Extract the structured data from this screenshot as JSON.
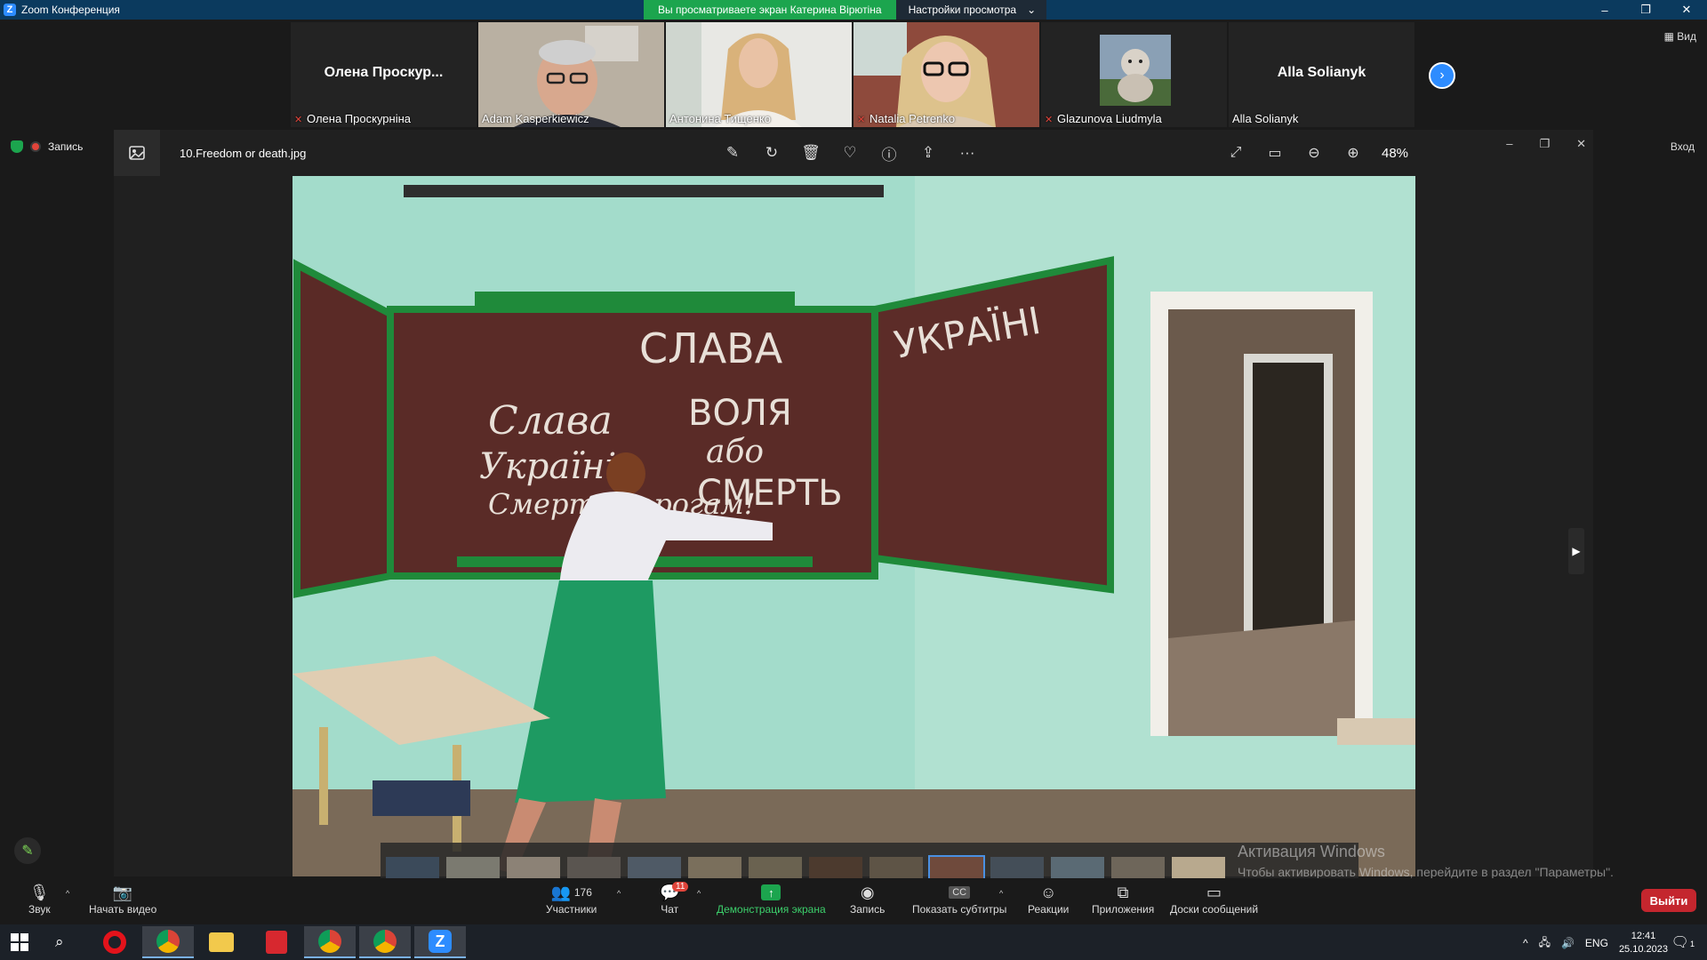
{
  "window": {
    "title": "Zoom Конференция",
    "logo": "Z"
  },
  "share_banner": {
    "viewing": "Вы просматриваете экран Катерина Вірютіна",
    "view_options": "Настройки просмотра"
  },
  "window_controls": {
    "minimize": "–",
    "restore": "❐",
    "close": "✕"
  },
  "gallery": {
    "tiles": [
      {
        "type": "name",
        "display_name": "Олена  Проскур...",
        "label": "Олена Проскурніна",
        "muted": true
      },
      {
        "type": "video",
        "label": "Adam Kasperkiewicz",
        "muted": false
      },
      {
        "type": "video",
        "label": "Антонина Тищенко",
        "muted": false,
        "active": true
      },
      {
        "type": "video",
        "label": "Natalia Petrenko",
        "muted": true
      },
      {
        "type": "avatar",
        "label": "Glazunova Liudmyla",
        "muted": true
      },
      {
        "type": "name",
        "display_name": "Alla Solianyk",
        "label": "Alla Solianyk",
        "muted": false
      }
    ],
    "next": "›",
    "view_label": "Вид"
  },
  "sidebar": {
    "recording_label": "Запись",
    "exit_label": "Вход"
  },
  "viewer": {
    "filename": "10.Freedom or death.jpg",
    "zoom": "48%",
    "tools": [
      "edit-icon",
      "rotate-icon",
      "delete-icon",
      "favorite-icon",
      "info-icon",
      "share-icon",
      "more-icon"
    ],
    "more": "···",
    "nav_next": "▶"
  },
  "photo": {
    "board_text_1": "СЛАВА",
    "board_text_2": "УКРАЇНІ",
    "board_left": [
      "Слава",
      "Україні",
      "Смерть ворогам!"
    ],
    "board_mid": [
      "ВОЛЯ",
      "або",
      "СМЕРТЬ"
    ]
  },
  "watermark": {
    "line1": "Активация Windows",
    "line2": "Чтобы активировать Windows, перейдите в раздел \"Параметры\"."
  },
  "toolbar": {
    "audio": "Звук",
    "video": "Начать видео",
    "participants": "Участники",
    "participants_count": "176",
    "chat": "Чат",
    "chat_badge": "11",
    "share": "Демонстрация экрана",
    "record": "Запись",
    "captions": "Показать субтитры",
    "captions_icon": "CC",
    "reactions": "Реакции",
    "apps": "Приложения",
    "whiteboards": "Доски сообщений",
    "leave": "Выйти",
    "caret": "^"
  },
  "taskbar": {
    "lang": "ENG",
    "time": "12:41",
    "date": "25.10.2023",
    "notification_count": "1"
  },
  "colors": {
    "accent": "#2d8cff",
    "share_green": "#1ca54e",
    "leave_red": "#c4262e",
    "title_bar": "#0b3a5e"
  }
}
